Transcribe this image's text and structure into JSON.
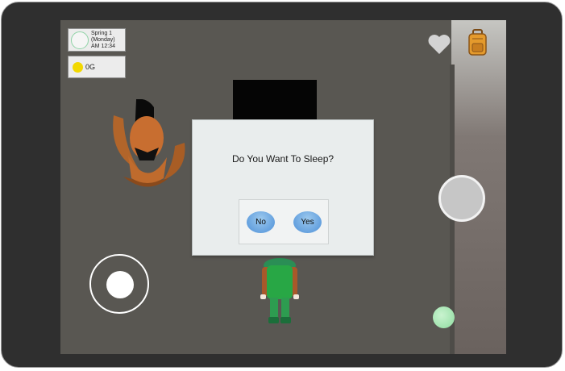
{
  "hud": {
    "date_line1": "Spring 1",
    "date_line2": "(Monday)",
    "time": "AM 12:34",
    "money": "0G"
  },
  "icons": {
    "favorite": "heart-icon",
    "inventory": "backpack-icon",
    "currency": "coin-icon"
  },
  "dialog": {
    "prompt": "Do You Want To Sleep?",
    "no_label": "No",
    "yes_label": "Yes"
  },
  "colors": {
    "floor": "#595752",
    "dialog_bg": "#e9eded",
    "button_blue": "#4e90d8",
    "coin": "#f2d800",
    "player_shirt": "#28a745"
  }
}
